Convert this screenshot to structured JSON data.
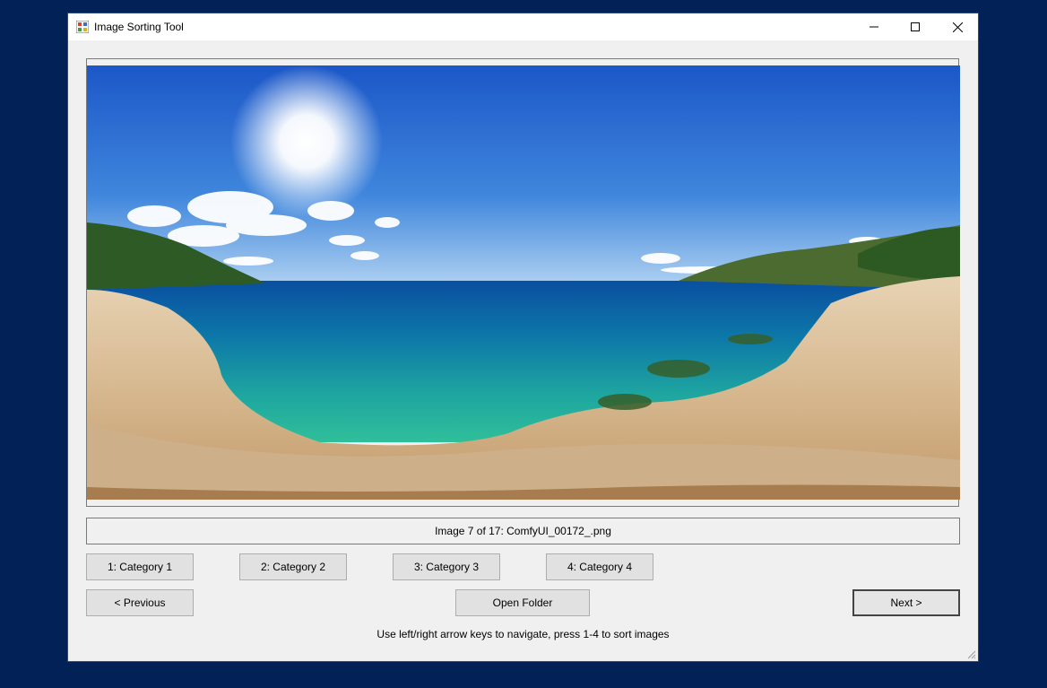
{
  "window": {
    "title": "Image Sorting Tool",
    "controls": [
      "minimize-icon",
      "maximize-icon",
      "close-icon"
    ]
  },
  "viewer": {
    "image_description_icon": "panorama-image"
  },
  "status": {
    "text": "Image 7 of 17: ComfyUI_00172_.png"
  },
  "categories": [
    {
      "label": "1: Category 1"
    },
    {
      "label": "2: Category 2"
    },
    {
      "label": "3: Category 3"
    },
    {
      "label": "4: Category 4"
    }
  ],
  "navigation": {
    "previous_label": "< Previous",
    "open_folder_label": "Open Folder",
    "next_label": "Next >"
  },
  "hint": {
    "text": "Use left/right arrow keys to navigate, press 1-4 to sort images"
  },
  "colors": {
    "desktop": "#022257",
    "window_bg": "#f0f0f0",
    "button_bg": "#e1e1e1"
  }
}
